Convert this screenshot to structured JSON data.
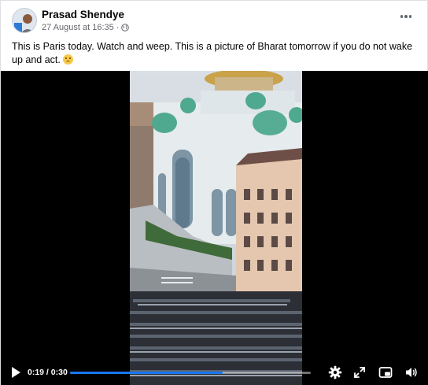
{
  "post": {
    "author": "Prasad Shendye",
    "date": "27 August at 16:35 ·",
    "privacy_icon": "globe-icon",
    "more_icon": "more-options-icon",
    "caption": "This is Paris today. Watch and weep. This is a picture of  Bharat tomorrow if you do not wake up and act.",
    "caption_emoji": "thinking-face-emoji"
  },
  "video": {
    "time_display": "0:19 / 0:30",
    "progress": 0.633,
    "accent_color": "#1877f2",
    "controls": [
      "play-icon",
      "settings-icon",
      "fullscreen-icon",
      "pip-icon",
      "volume-icon"
    ]
  }
}
